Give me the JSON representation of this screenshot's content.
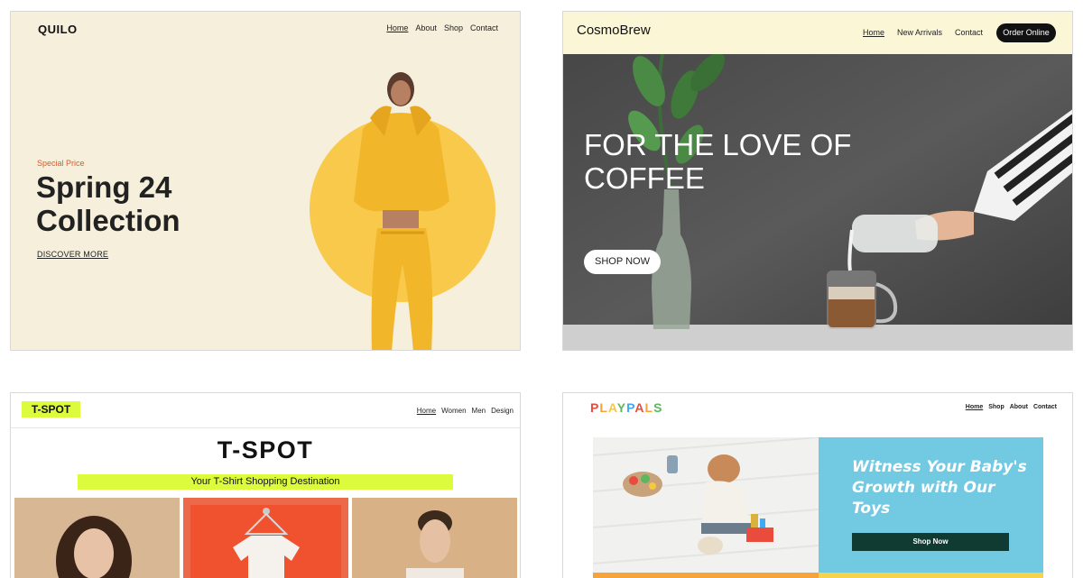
{
  "quilo": {
    "logo": "QUILO",
    "nav": [
      "Home",
      "About",
      "Shop",
      "Contact"
    ],
    "eyebrow": "Special Price",
    "headline": "Spring 24 Collection",
    "cta": "DISCOVER MORE",
    "colors": {
      "bg": "#f5efdb",
      "accent": "#e2552b",
      "circle": "#f8c94a"
    }
  },
  "cosmobrew": {
    "logo": "CosmoBrew",
    "nav": [
      "Home",
      "New Arrivals",
      "Contact"
    ],
    "order_button": "Order Online",
    "headline": "FOR THE LOVE OF COFFEE",
    "cta": "SHOP NOW",
    "colors": {
      "header_bg": "#fbf6d6"
    }
  },
  "tspot": {
    "logo": "T-SPOT",
    "nav": [
      "Home",
      "Women",
      "Men",
      "Design"
    ],
    "title": "T-SPOT",
    "tagline": "Your T-Shirt Shopping Destination",
    "colors": {
      "accent": "#dcfb3d"
    }
  },
  "playpals": {
    "logo_letters": [
      "P",
      "L",
      "A",
      "Y",
      "P",
      "A",
      "L",
      "S"
    ],
    "logo_colors": [
      "#e94b3c",
      "#f6a33a",
      "#f5c842",
      "#5cb85c",
      "#3fa9f5",
      "#e94b3c",
      "#f6a33a",
      "#5cb85c"
    ],
    "nav": [
      "Home",
      "Shop",
      "About",
      "Contact"
    ],
    "headline": "Witness Your Baby's Growth with Our Toys",
    "cta": "Shop Now",
    "colors": {
      "panel": "#72c9e2",
      "button": "#0f3b32"
    }
  }
}
